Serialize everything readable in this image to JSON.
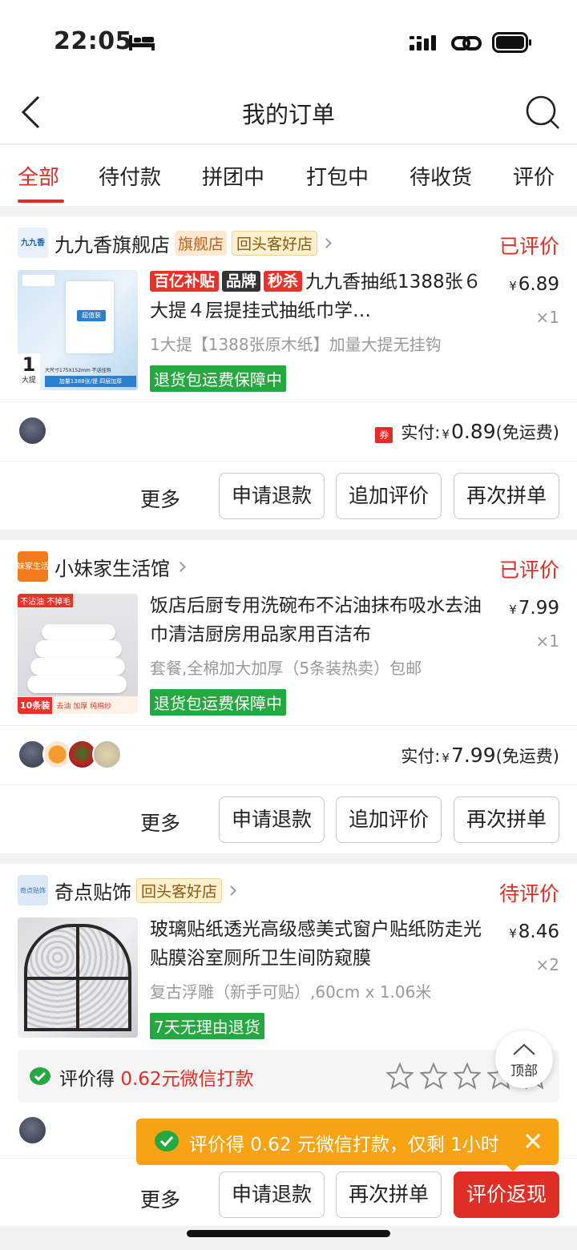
{
  "status_bar": {
    "time": "22:05"
  },
  "nav": {
    "title": "我的订单"
  },
  "tabs": [
    "全部",
    "待付款",
    "拼团中",
    "打包中",
    "待收货",
    "评价"
  ],
  "orders": [
    {
      "store": {
        "name": "九九香旗舰店",
        "logo_text": "九九香",
        "tags": [
          "旗舰店",
          "回头客好店"
        ]
      },
      "status": "已评价",
      "product": {
        "badges": [
          "百亿补贴",
          "品牌",
          "秒杀"
        ],
        "title": "九九香抽纸1388张６大提４层提挂式抽纸巾学…",
        "sku": "1大提【1388张原木纸】加量大提无挂钩",
        "guarantee": "退货包运费保障中",
        "price": "6.89",
        "qty": "×1",
        "img_texts": [
          "大尺寸175X152mm 不送挂钩",
          "加量1388张/提 四层加厚",
          "1",
          "大提",
          "超值装"
        ]
      },
      "coupon": "券",
      "paid_label": "实付:",
      "paid_amount": "0.89",
      "shipping": "(免运费)",
      "actions": {
        "more": "更多",
        "buttons": [
          "申请退款",
          "追加评价",
          "再次拼单"
        ]
      }
    },
    {
      "store": {
        "name": "小妹家生活馆",
        "logo_text": "小妹家生活馆"
      },
      "status": "已评价",
      "product": {
        "title": "饭店后厨专用洗碗布不沾油抹布吸水去油巾清洁厨房用品家用百洁布",
        "sku": "套餐,全棉加大加厚（5条装热卖）包邮",
        "guarantee": "退货包运费保障中",
        "price": "7.99",
        "qty": "×1",
        "img_texts": [
          "不沾油 不掉毛",
          "10条装",
          "去油 加厚 纯棉纱"
        ]
      },
      "paid_label": "实付:",
      "paid_amount": "7.99",
      "shipping": "(免运费)",
      "actions": {
        "more": "更多",
        "buttons": [
          "申请退款",
          "追加评价",
          "再次拼单"
        ]
      }
    },
    {
      "store": {
        "name": "奇点贴饰",
        "logo_text": "奇点贴饰",
        "tags": [
          "回头客好店"
        ]
      },
      "status": "待评价",
      "product": {
        "title": "玻璃贴纸透光高级感美式窗户贴纸防走光贴膜浴室厕所卫生间防窥膜",
        "sku": "复古浮雕（新手可贴）,60cm x 1.06米",
        "guarantee": "7天无理由退货",
        "price": "8.46",
        "qty": "×2"
      },
      "reward": {
        "prefix": "评价得",
        "amount": "0.62元微信打款",
        "star_count": 5
      },
      "actions": {
        "more": "更多",
        "buttons": [
          "申请退款",
          "再次拼单",
          "评价返现"
        ]
      }
    }
  ],
  "currency": "¥",
  "toast": {
    "text": "评价得 0.62 元微信打款，仅剩 1小时"
  },
  "back_to_top": "顶部",
  "colors": {
    "accent": "#e02e24",
    "green": "#25a83f",
    "toast": "#f7a313"
  }
}
